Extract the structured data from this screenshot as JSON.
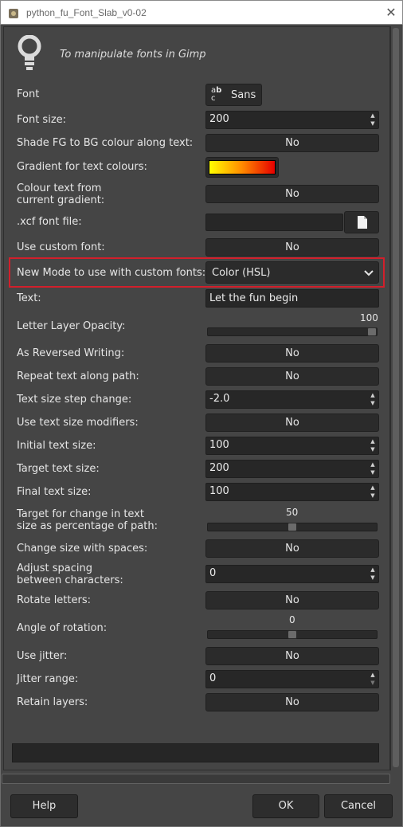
{
  "window": {
    "title": "python_fu_Font_Slab_v0-02",
    "close_icon": "close-icon"
  },
  "header": {
    "description": "To manipulate fonts in Gimp",
    "icon": "lightbulb-icon"
  },
  "fields": {
    "font": {
      "label": "Font",
      "value": "Sans",
      "icon": "font-icon"
    },
    "font_size": {
      "label": "Font size:",
      "value": "200"
    },
    "shade": {
      "label": "Shade FG to BG colour along text:",
      "value": "No"
    },
    "gradient": {
      "label": "Gradient for text colours:",
      "stops": [
        "#ffff00",
        "#ff8a00",
        "#e60000"
      ]
    },
    "colour_text": {
      "label": "Colour text from\ncurrent gradient:",
      "value": "No"
    },
    "xcf": {
      "label": ".xcf font file:",
      "value": "",
      "icon": "file-icon"
    },
    "custom_font": {
      "label": "Use custom font:",
      "value": "No"
    },
    "mode": {
      "label": "New Mode to use with custom fonts:",
      "value": "Color (HSL)"
    },
    "text": {
      "label": "Text:",
      "value": "Let the fun begin"
    },
    "opacity": {
      "label": "Letter Layer Opacity:",
      "value": "100",
      "fraction": 1.0
    },
    "reversed": {
      "label": "As Reversed Writing:",
      "value": "No"
    },
    "repeat": {
      "label": "Repeat text along path:",
      "value": "No"
    },
    "step": {
      "label": "Text size step change:",
      "value": "-2.0"
    },
    "modifiers": {
      "label": "Use text size modifiers:",
      "value": "No"
    },
    "initial": {
      "label": "Initial text size:",
      "value": "100"
    },
    "target": {
      "label": "Target text size:",
      "value": "200"
    },
    "final": {
      "label": "Final text size:",
      "value": "100"
    },
    "target_pct": {
      "label": "Target for change in text\nsize as percentage of path:",
      "value": "50",
      "fraction": 0.5
    },
    "spaces": {
      "label": "Change size with spaces:",
      "value": "No"
    },
    "spacing": {
      "label": "Adjust spacing\nbetween characters:",
      "value": "0"
    },
    "rotate": {
      "label": "Rotate letters:",
      "value": "No"
    },
    "angle": {
      "label": "Angle of rotation:",
      "value": "0",
      "fraction": 0.5
    },
    "jitter": {
      "label": "Use jitter:",
      "value": "No"
    },
    "jitter_range": {
      "label": "Jitter range:",
      "value": "0"
    },
    "retain": {
      "label": "Retain layers:",
      "value": "No"
    }
  },
  "footer": {
    "help": "Help",
    "ok": "OK",
    "cancel": "Cancel"
  },
  "colors": {
    "highlight": "#d21f2b",
    "background": "#454545"
  }
}
